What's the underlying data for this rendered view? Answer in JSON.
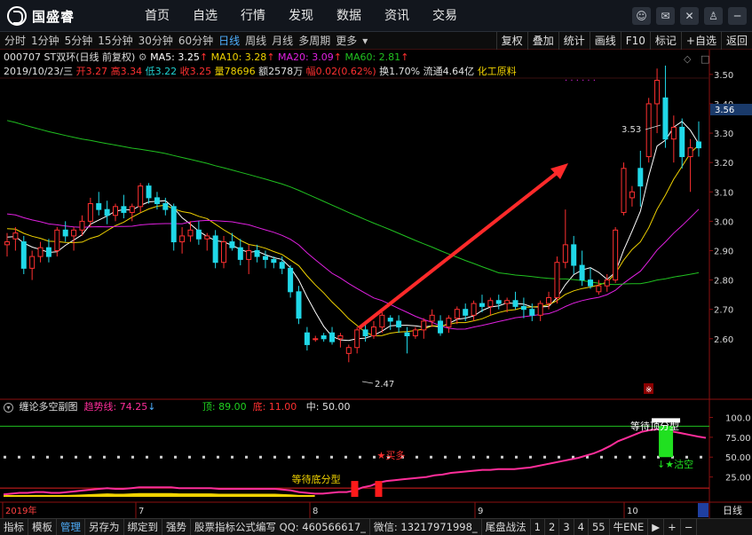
{
  "app": {
    "logo_text": "国盛睿",
    "nav": [
      "首页",
      "自选",
      "行情",
      "发现",
      "数据",
      "资讯",
      "交易"
    ],
    "window_buttons": [
      "☺",
      "✉",
      "✕",
      "♙",
      "─"
    ]
  },
  "toolbar": {
    "periods": [
      "分时",
      "1分钟",
      "5分钟",
      "15分钟",
      "30分钟",
      "60分钟",
      "日线",
      "周线",
      "月线",
      "多周期",
      "更多"
    ],
    "active_period": "日线",
    "tools": [
      "复权",
      "叠加",
      "统计",
      "画线",
      "F10",
      "标记",
      "+自选",
      "返回"
    ]
  },
  "stock": {
    "code_name": "000707 ST双环(日线 前复权)",
    "ma5_label": "MA5: 3.25",
    "ma10_label": "MA10: 3.28",
    "ma20_label": "MA20: 3.09",
    "ma60_label": "MA60: 2.81",
    "date": "2019/10/23/三",
    "open": "开3.27",
    "high": "高3.34",
    "low": "低3.22",
    "close": "收3.25",
    "volume": "量78696",
    "amount": "额2578万",
    "change": "幅0.02(0.62%)",
    "turnover": "换1.70%",
    "float": "流通4.64亿",
    "sector": "化工原料",
    "current_price_tag": "3.56",
    "high_mark": "3.53",
    "low_mark": "2.47"
  },
  "indicator": {
    "name": "缠论多空副图",
    "trend_label": "趋势线: 74.25",
    "top_label": "顶: 89.00",
    "bottom_label": "底: 11.00",
    "mid_label": "中: 50.00",
    "buy_label": "买多",
    "wait_bottom": "等待底分型",
    "wait_top": "等待顶分型",
    "sell_label": "沽空"
  },
  "time_axis": {
    "labels": [
      "2019年",
      "7",
      "8",
      "9",
      "10"
    ],
    "period_button": "日线"
  },
  "bottom_tabs": [
    "指标",
    "模板",
    "管理",
    "另存为",
    "绑定到",
    "强势",
    "股票指标公式编写 QQ: 460566617_",
    "微信: 13217971998_",
    "尾盘战法",
    "1",
    "2",
    "3",
    "4",
    "55",
    "牛ENE",
    "▶",
    "+",
    "−"
  ],
  "bottom_selected": "管理",
  "chart_data": [
    {
      "type": "candlestick",
      "title": "000707 ST双环(日线 前复权)",
      "ylim": [
        2.4,
        3.56
      ],
      "y_ticks": [
        2.6,
        2.7,
        2.8,
        2.9,
        3.0,
        3.1,
        3.2,
        3.3,
        3.4,
        3.5
      ],
      "y_tick_labels": [
        "2.60",
        "2.70",
        "2.80",
        "2.90",
        "3.00",
        "3.10",
        "3.20",
        "3.30",
        "3.40",
        "3.50"
      ],
      "x_labels": [
        "2019年",
        "7",
        "8",
        "9",
        "10"
      ],
      "candles": [
        {
          "o": 2.92,
          "h": 2.96,
          "l": 2.88,
          "c": 2.93
        },
        {
          "o": 2.94,
          "h": 2.98,
          "l": 2.9,
          "c": 2.96
        },
        {
          "o": 2.93,
          "h": 2.95,
          "l": 2.82,
          "c": 2.84
        },
        {
          "o": 2.84,
          "h": 2.9,
          "l": 2.8,
          "c": 2.88
        },
        {
          "o": 2.88,
          "h": 2.93,
          "l": 2.86,
          "c": 2.91
        },
        {
          "o": 2.91,
          "h": 2.94,
          "l": 2.86,
          "c": 2.88
        },
        {
          "o": 2.9,
          "h": 2.98,
          "l": 2.88,
          "c": 2.97
        },
        {
          "o": 2.97,
          "h": 3.0,
          "l": 2.93,
          "c": 2.95
        },
        {
          "o": 2.95,
          "h": 2.98,
          "l": 2.9,
          "c": 2.97
        },
        {
          "o": 2.97,
          "h": 3.02,
          "l": 2.95,
          "c": 3.0
        },
        {
          "o": 3.0,
          "h": 3.08,
          "l": 2.98,
          "c": 3.06
        },
        {
          "o": 3.06,
          "h": 3.1,
          "l": 3.02,
          "c": 3.04
        },
        {
          "o": 3.04,
          "h": 3.07,
          "l": 2.99,
          "c": 3.02
        },
        {
          "o": 3.02,
          "h": 3.06,
          "l": 3.0,
          "c": 3.05
        },
        {
          "o": 3.05,
          "h": 3.09,
          "l": 3.01,
          "c": 3.03
        },
        {
          "o": 3.03,
          "h": 3.06,
          "l": 3.0,
          "c": 3.05
        },
        {
          "o": 3.05,
          "h": 3.13,
          "l": 3.03,
          "c": 3.12
        },
        {
          "o": 3.12,
          "h": 3.13,
          "l": 3.06,
          "c": 3.08
        },
        {
          "o": 3.08,
          "h": 3.1,
          "l": 3.04,
          "c": 3.06
        },
        {
          "o": 3.06,
          "h": 3.08,
          "l": 3.02,
          "c": 3.04
        },
        {
          "o": 3.05,
          "h": 3.06,
          "l": 2.9,
          "c": 2.93
        },
        {
          "o": 2.93,
          "h": 2.98,
          "l": 2.89,
          "c": 2.95
        },
        {
          "o": 2.95,
          "h": 3.0,
          "l": 2.93,
          "c": 2.97
        },
        {
          "o": 2.97,
          "h": 3.0,
          "l": 2.92,
          "c": 2.94
        },
        {
          "o": 2.94,
          "h": 2.96,
          "l": 2.9,
          "c": 2.95
        },
        {
          "o": 2.95,
          "h": 2.97,
          "l": 2.84,
          "c": 2.86
        },
        {
          "o": 2.86,
          "h": 2.95,
          "l": 2.84,
          "c": 2.93
        },
        {
          "o": 2.93,
          "h": 2.96,
          "l": 2.9,
          "c": 2.91
        },
        {
          "o": 2.91,
          "h": 2.94,
          "l": 2.85,
          "c": 2.87
        },
        {
          "o": 2.87,
          "h": 2.92,
          "l": 2.82,
          "c": 2.9
        },
        {
          "o": 2.9,
          "h": 2.92,
          "l": 2.86,
          "c": 2.88
        },
        {
          "o": 2.88,
          "h": 2.9,
          "l": 2.84,
          "c": 2.87
        },
        {
          "o": 2.87,
          "h": 2.88,
          "l": 2.84,
          "c": 2.86
        },
        {
          "o": 2.86,
          "h": 2.88,
          "l": 2.82,
          "c": 2.84
        },
        {
          "o": 2.84,
          "h": 2.85,
          "l": 2.74,
          "c": 2.76
        },
        {
          "o": 2.76,
          "h": 2.78,
          "l": 2.65,
          "c": 2.67
        },
        {
          "o": 2.62,
          "h": 2.64,
          "l": 2.56,
          "c": 2.58
        },
        {
          "o": 2.6,
          "h": 2.61,
          "l": 2.59,
          "c": 2.6
        },
        {
          "o": 2.61,
          "h": 2.62,
          "l": 2.59,
          "c": 2.6
        },
        {
          "o": 2.62,
          "h": 2.64,
          "l": 2.58,
          "c": 2.59
        },
        {
          "o": 2.6,
          "h": 2.62,
          "l": 2.57,
          "c": 2.61
        },
        {
          "o": 2.55,
          "h": 2.58,
          "l": 2.52,
          "c": 2.57
        },
        {
          "o": 2.57,
          "h": 2.64,
          "l": 2.55,
          "c": 2.63
        },
        {
          "o": 2.63,
          "h": 2.66,
          "l": 2.59,
          "c": 2.61
        },
        {
          "o": 2.61,
          "h": 2.66,
          "l": 2.6,
          "c": 2.64
        },
        {
          "o": 2.64,
          "h": 2.69,
          "l": 2.62,
          "c": 2.68
        },
        {
          "o": 2.67,
          "h": 2.68,
          "l": 2.63,
          "c": 2.66
        },
        {
          "o": 2.66,
          "h": 2.68,
          "l": 2.62,
          "c": 2.64
        },
        {
          "o": 2.62,
          "h": 2.64,
          "l": 2.55,
          "c": 2.61
        },
        {
          "o": 2.61,
          "h": 2.64,
          "l": 2.6,
          "c": 2.63
        },
        {
          "o": 2.63,
          "h": 2.67,
          "l": 2.6,
          "c": 2.66
        },
        {
          "o": 2.66,
          "h": 2.7,
          "l": 2.64,
          "c": 2.68
        },
        {
          "o": 2.66,
          "h": 2.68,
          "l": 2.61,
          "c": 2.62
        },
        {
          "o": 2.64,
          "h": 2.68,
          "l": 2.62,
          "c": 2.67
        },
        {
          "o": 2.67,
          "h": 2.71,
          "l": 2.65,
          "c": 2.7
        },
        {
          "o": 2.7,
          "h": 2.72,
          "l": 2.66,
          "c": 2.68
        },
        {
          "o": 2.68,
          "h": 2.73,
          "l": 2.66,
          "c": 2.72
        },
        {
          "o": 2.72,
          "h": 2.75,
          "l": 2.69,
          "c": 2.71
        },
        {
          "o": 2.71,
          "h": 2.74,
          "l": 2.68,
          "c": 2.73
        },
        {
          "o": 2.73,
          "h": 2.75,
          "l": 2.7,
          "c": 2.72
        },
        {
          "o": 2.72,
          "h": 2.74,
          "l": 2.69,
          "c": 2.73
        },
        {
          "o": 2.73,
          "h": 2.76,
          "l": 2.7,
          "c": 2.71
        },
        {
          "o": 2.71,
          "h": 2.74,
          "l": 2.67,
          "c": 2.7
        },
        {
          "o": 2.7,
          "h": 2.72,
          "l": 2.66,
          "c": 2.68
        },
        {
          "o": 2.68,
          "h": 2.73,
          "l": 2.66,
          "c": 2.72
        },
        {
          "o": 2.72,
          "h": 2.76,
          "l": 2.7,
          "c": 2.74
        },
        {
          "o": 2.74,
          "h": 2.88,
          "l": 2.72,
          "c": 2.86
        },
        {
          "o": 2.86,
          "h": 3.04,
          "l": 2.84,
          "c": 2.92
        },
        {
          "o": 2.92,
          "h": 2.95,
          "l": 2.82,
          "c": 2.85
        },
        {
          "o": 2.85,
          "h": 2.9,
          "l": 2.78,
          "c": 2.8
        },
        {
          "o": 2.8,
          "h": 2.84,
          "l": 2.77,
          "c": 2.78
        },
        {
          "o": 2.76,
          "h": 2.8,
          "l": 2.75,
          "c": 2.78
        },
        {
          "o": 2.78,
          "h": 2.82,
          "l": 2.76,
          "c": 2.8
        },
        {
          "o": 2.8,
          "h": 2.98,
          "l": 2.79,
          "c": 2.97
        },
        {
          "o": 3.03,
          "h": 3.2,
          "l": 3.02,
          "c": 3.18
        },
        {
          "o": 3.08,
          "h": 3.12,
          "l": 3.05,
          "c": 3.1
        },
        {
          "o": 3.18,
          "h": 3.24,
          "l": 3.05,
          "c": 3.12
        },
        {
          "o": 3.22,
          "h": 3.42,
          "l": 3.2,
          "c": 3.4
        },
        {
          "o": 3.4,
          "h": 3.52,
          "l": 3.3,
          "c": 3.48
        },
        {
          "o": 3.42,
          "h": 3.53,
          "l": 3.25,
          "c": 3.28
        },
        {
          "o": 3.28,
          "h": 3.36,
          "l": 3.2,
          "c": 3.32
        },
        {
          "o": 3.32,
          "h": 3.35,
          "l": 3.18,
          "c": 3.22
        },
        {
          "o": 3.22,
          "h": 3.28,
          "l": 3.1,
          "c": 3.25
        },
        {
          "o": 3.27,
          "h": 3.34,
          "l": 3.22,
          "c": 3.25
        }
      ],
      "ma_colors": {
        "ma5": "#ffffff",
        "ma10": "#f0d200",
        "ma20": "#e020e0",
        "ma60": "#20c020"
      }
    },
    {
      "type": "line",
      "title": "缠论多空副图",
      "ylim": [
        0,
        105
      ],
      "y_ticks": [
        25,
        50,
        75,
        100
      ],
      "y_tick_labels": [
        "25.00",
        "50.00",
        "75.00",
        "100.0"
      ],
      "series": [
        {
          "name": "趋势线",
          "values": [
            3,
            4,
            5,
            5,
            6,
            6,
            5,
            5,
            6,
            7,
            8,
            9,
            10,
            11,
            10,
            10,
            11,
            12,
            12,
            12,
            12,
            12,
            11,
            11,
            11,
            11,
            11,
            10,
            10,
            10,
            10,
            10,
            10,
            10,
            10,
            9,
            8,
            6,
            5,
            4,
            4,
            5,
            6,
            6,
            8,
            12,
            14,
            18,
            20,
            21,
            22,
            23,
            24,
            25,
            27,
            28,
            30,
            31,
            32,
            33,
            34,
            34,
            35,
            35,
            35,
            36,
            37,
            39,
            41,
            43,
            45,
            47,
            49,
            52,
            55,
            59,
            64,
            70,
            74,
            78,
            82,
            84,
            85,
            84,
            82,
            80,
            78,
            76,
            74.25
          ]
        }
      ],
      "reference_lines": [
        89,
        50,
        11
      ],
      "signal_marks": {
        "buy_bars": 2,
        "sell_bar": 1
      }
    }
  ]
}
